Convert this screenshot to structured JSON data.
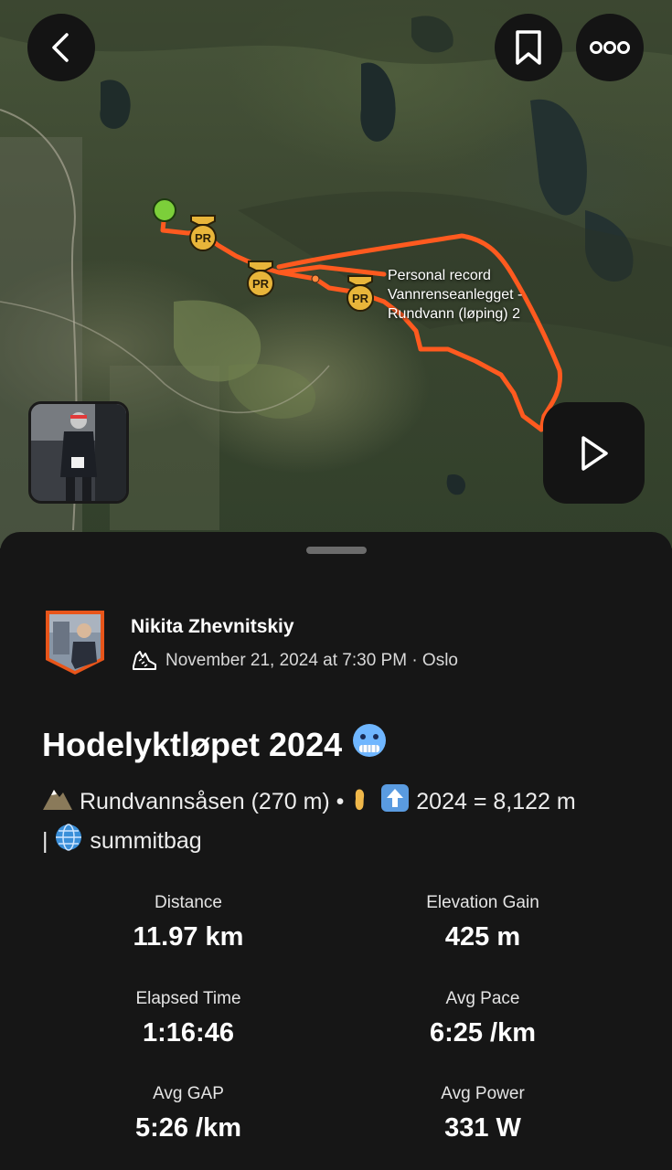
{
  "header": {
    "back_icon": "chevron-left-icon",
    "bookmark_icon": "bookmark-icon",
    "more_icon": "more-dots-icon"
  },
  "map": {
    "pr_badge_text": "PR",
    "segment_label_lines": [
      "Personal record",
      "Vannrenseanlegget -",
      "Rundvann (løping) 2"
    ],
    "route_color": "#ff5a1f",
    "start_color": "#7ccf3a",
    "pr_badge_color": "#e8b53a",
    "play_icon": "play-icon"
  },
  "athlete": {
    "name": "Nikita Zhevnitskiy",
    "activity_icon": "running-shoe-icon",
    "datetime_location": "November 21, 2024 at 7:30 PM · Oslo"
  },
  "activity": {
    "title": "Hodelyktløpet 2024",
    "title_emoji": "🥶",
    "description_parts": {
      "mountain_emoji": "⛰️",
      "summit": "Rundvannsåsen (270 m) •",
      "foot_emoji": "🦶",
      "up_emoji": "⬆️",
      "year_total": "2024 = 8,122 m",
      "separator": "|",
      "globe_emoji": "🌐",
      "tag": "summitbag"
    }
  },
  "stats": [
    {
      "label": "Distance",
      "value": "11.97 km"
    },
    {
      "label": "Elevation Gain",
      "value": "425 m"
    },
    {
      "label": "Elapsed Time",
      "value": "1:16:46"
    },
    {
      "label": "Avg Pace",
      "value": "6:25 /km"
    },
    {
      "label": "Avg GAP",
      "value": "5:26 /km"
    },
    {
      "label": "Avg Power",
      "value": "331 W"
    }
  ]
}
